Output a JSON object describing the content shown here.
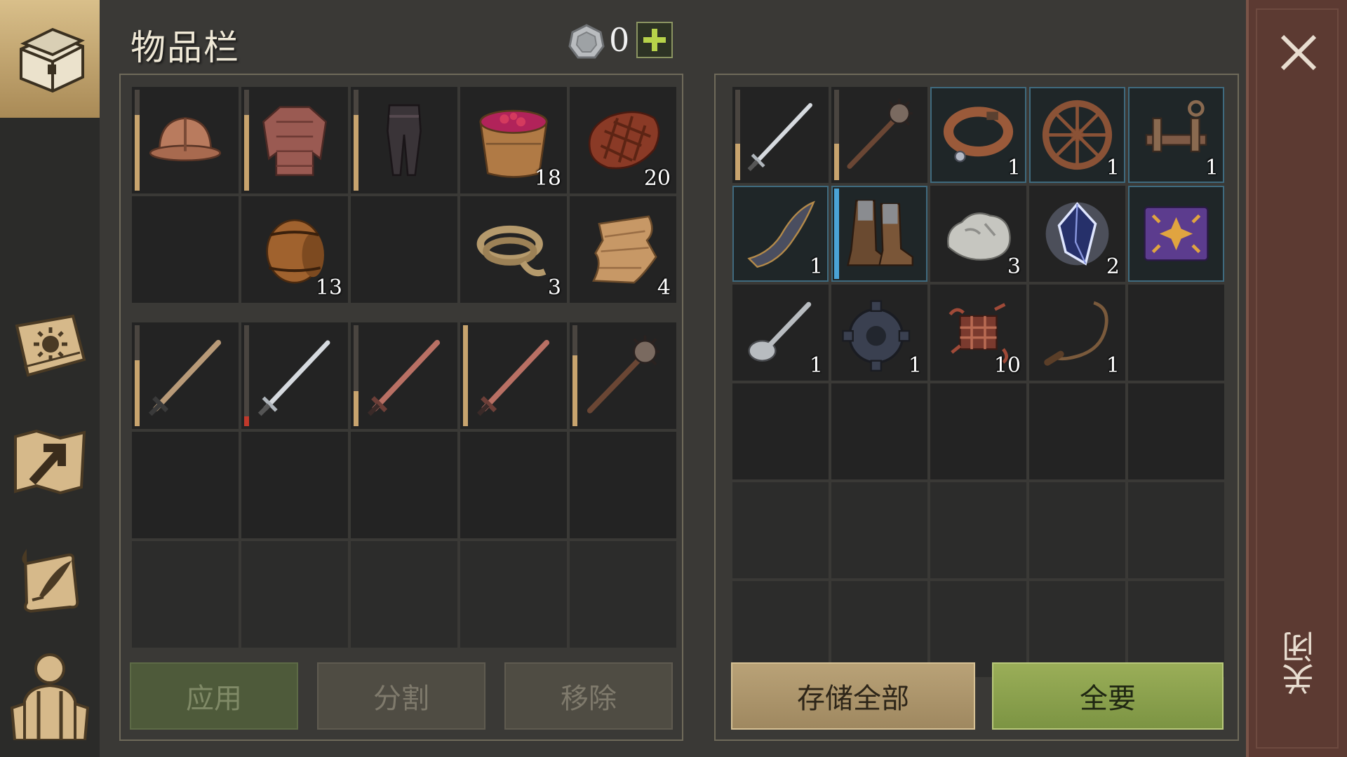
{
  "header": {
    "title": "物品栏",
    "currency_value": "0",
    "currency_icon": "silver-coin-icon",
    "add_icon": "plus-icon"
  },
  "sidebar": {
    "items": [
      {
        "name": "inventory-chest",
        "icon": "chest-icon",
        "active": true
      },
      {
        "name": "skills",
        "icon": "sun-book-icon",
        "active": false
      },
      {
        "name": "map",
        "icon": "map-arrow-icon",
        "active": false
      },
      {
        "name": "crafting",
        "icon": "scroll-quill-icon",
        "active": false
      },
      {
        "name": "character",
        "icon": "character-icon",
        "active": false
      }
    ]
  },
  "inventory": {
    "top": [
      {
        "item": "helmet-icon",
        "durability": 0.75
      },
      {
        "item": "chainmail-icon",
        "durability": 0.75
      },
      {
        "item": "chain-legs-icon",
        "durability": 0.75
      },
      {
        "item": "berry-bucket-icon",
        "qty": "18"
      },
      {
        "item": "meat-icon",
        "qty": "20"
      },
      {
        "item": ""
      },
      {
        "item": "barrel-icon",
        "qty": "13"
      },
      {
        "item": ""
      },
      {
        "item": "rope-icon",
        "qty": "3"
      },
      {
        "item": "cloth-icon",
        "qty": "4"
      }
    ],
    "bottom": [
      {
        "item": "sword-icon",
        "durability": 0.65
      },
      {
        "item": "steel-sword-icon",
        "durability": 0.1,
        "low": true
      },
      {
        "item": "copper-sword-icon",
        "durability": 0.35
      },
      {
        "item": "copper-sword-icon",
        "durability": 1.0
      },
      {
        "item": "mace-icon",
        "durability": 0.7
      },
      {
        "item": ""
      },
      {
        "item": ""
      },
      {
        "item": ""
      },
      {
        "item": ""
      },
      {
        "item": ""
      },
      {
        "item": "",
        "faded": true
      },
      {
        "item": "",
        "faded": true
      },
      {
        "item": "",
        "faded": true
      },
      {
        "item": "",
        "faded": true
      },
      {
        "item": "",
        "faded": true
      }
    ]
  },
  "storage": {
    "cells": [
      {
        "item": "steel-sword-icon",
        "durability": 0.4
      },
      {
        "item": "mace-icon",
        "durability": 0.4
      },
      {
        "item": "collar-icon",
        "qty": "1",
        "rare": true
      },
      {
        "item": "wheel-icon",
        "qty": "1",
        "rare": true
      },
      {
        "item": "mechanism-icon",
        "qty": "1",
        "rare": true
      },
      {
        "item": "bow-part-icon",
        "qty": "1",
        "rare": true
      },
      {
        "item": "boots-icon",
        "rare": true,
        "durability": 1.0,
        "blue": true
      },
      {
        "item": "stone-icon",
        "qty": "3"
      },
      {
        "item": "crystal-icon",
        "qty": "2"
      },
      {
        "item": "book-icon",
        "rare": true
      },
      {
        "item": "spoon-icon",
        "qty": "1"
      },
      {
        "item": "gear-icon",
        "qty": "1"
      },
      {
        "item": "scrap-icon",
        "qty": "10"
      },
      {
        "item": "whip-icon",
        "qty": "1"
      },
      {
        "item": ""
      },
      {
        "item": ""
      },
      {
        "item": ""
      },
      {
        "item": ""
      },
      {
        "item": ""
      },
      {
        "item": ""
      },
      {
        "item": "",
        "faded": true
      },
      {
        "item": "",
        "faded": true
      },
      {
        "item": "",
        "faded": true
      },
      {
        "item": "",
        "faded": true
      },
      {
        "item": "",
        "faded": true
      },
      {
        "item": "",
        "faded": true
      },
      {
        "item": "",
        "faded": true
      },
      {
        "item": "",
        "faded": true
      },
      {
        "item": "",
        "faded": true
      },
      {
        "item": "",
        "faded": true
      }
    ]
  },
  "buttons": {
    "apply": "应用",
    "split": "分割",
    "remove": "移除",
    "store_all": "存储全部",
    "take_all": "全要"
  },
  "close": {
    "label": "关闭",
    "icon": "close-icon"
  },
  "colors": {
    "accent_gold": "#c8a46e",
    "take_all_green": "#8aa24c",
    "close_bar": "#5c3a32",
    "rare_border": "#3f6a7e"
  }
}
